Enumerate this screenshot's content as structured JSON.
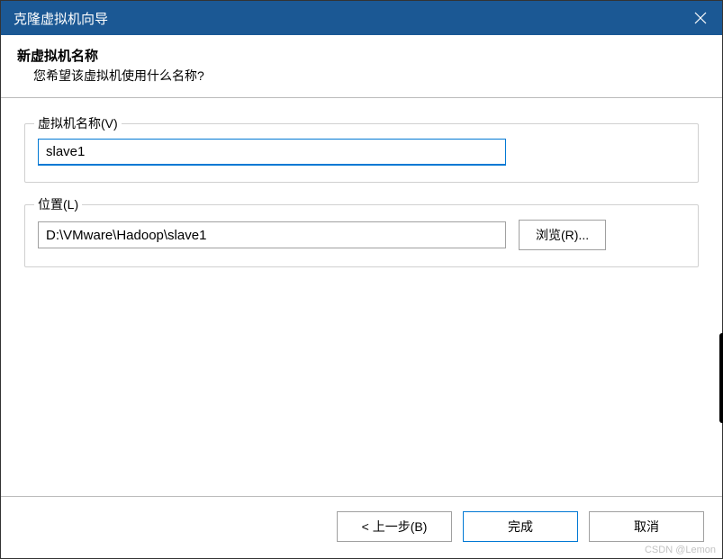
{
  "titlebar": {
    "title": "克隆虚拟机向导"
  },
  "header": {
    "title": "新虚拟机名称",
    "subtitle": "您希望该虚拟机使用什么名称?"
  },
  "fields": {
    "name": {
      "legend": "虚拟机名称(V)",
      "value": "slave1"
    },
    "location": {
      "legend": "位置(L)",
      "value": "D:\\VMware\\Hadoop\\slave1",
      "browse_label": "浏览(R)..."
    }
  },
  "footer": {
    "back_label": "< 上一步(B)",
    "finish_label": "完成",
    "cancel_label": "取消"
  },
  "watermark": "CSDN @Lemon"
}
